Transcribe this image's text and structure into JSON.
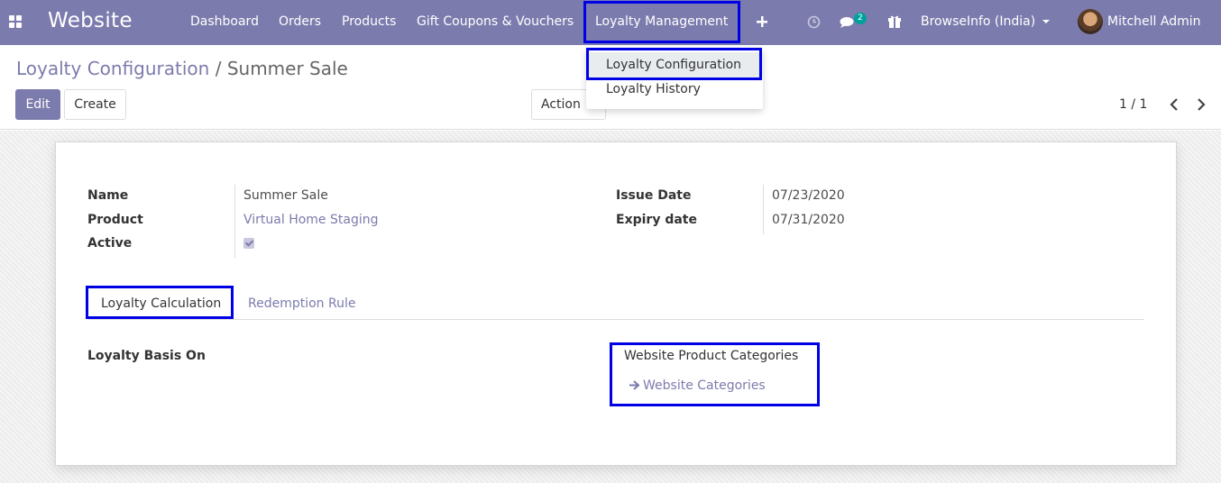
{
  "navbar": {
    "brand": "Website",
    "menu": [
      "Dashboard",
      "Orders",
      "Products",
      "Gift Coupons & Vouchers",
      "Loyalty Management"
    ],
    "add_icon": "plus-icon",
    "activity_icon": "clock-icon",
    "messages_icon": "chat-icon",
    "messages_count": "2",
    "gift_icon": "gift-icon",
    "company": "BrowseInfo (India)",
    "user": "Mitchell Admin",
    "accent_color": "#7c7bad",
    "badge_color": "#00a09d"
  },
  "dropdown": {
    "items": [
      "Loyalty Configuration",
      "Loyalty History"
    ]
  },
  "breadcrumb": {
    "parent": "Loyalty Configuration",
    "separator": "/",
    "current": "Summer Sale"
  },
  "buttons": {
    "edit": "Edit",
    "create": "Create",
    "action": "Action"
  },
  "pager": {
    "value": "1 / 1"
  },
  "form": {
    "fields_left": [
      {
        "label": "Name",
        "value": "Summer Sale"
      },
      {
        "label": "Product",
        "value": "Virtual Home Staging"
      },
      {
        "label": "Active",
        "value": ""
      }
    ],
    "active_checked": true,
    "fields_right": [
      {
        "label": "Issue Date",
        "value": "07/23/2020"
      },
      {
        "label": "Expiry date",
        "value": "07/31/2020"
      }
    ],
    "tabs": [
      "Loyalty Calculation",
      "Redemption Rule"
    ],
    "active_tab": "Loyalty Calculation",
    "basis_label": "Loyalty Basis On",
    "basis_value": "Website Product Categories",
    "basis_link": "Website Categories"
  },
  "highlight_color": "#0000e6"
}
